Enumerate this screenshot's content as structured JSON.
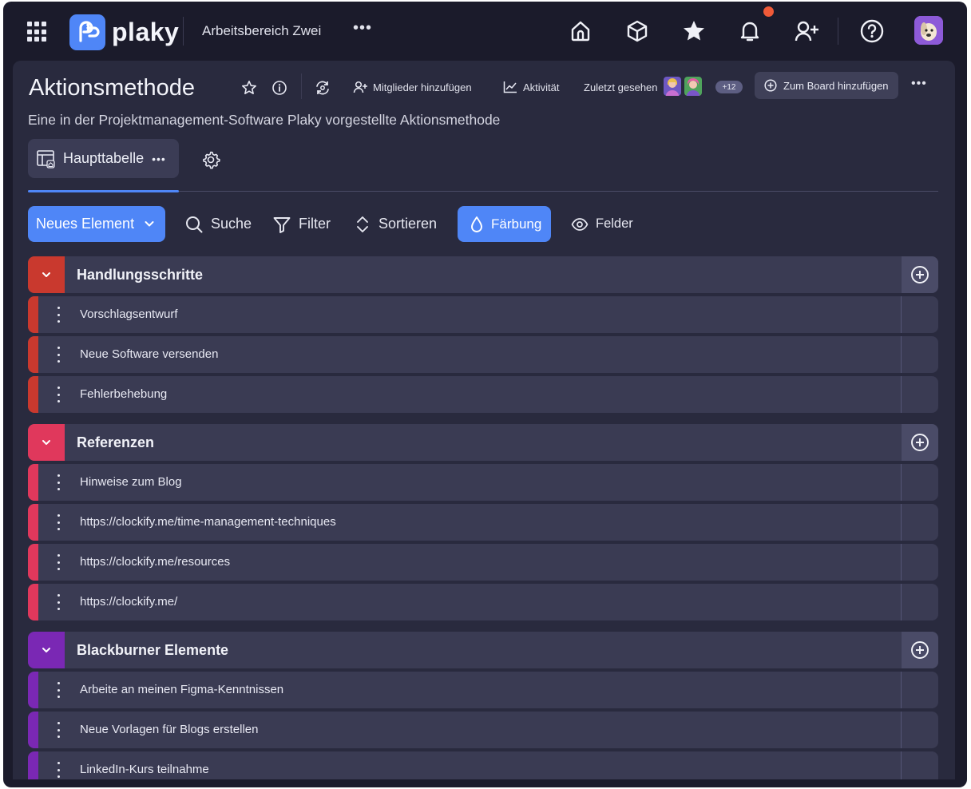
{
  "topbar": {
    "logo_text": "plaky",
    "workspace": "Arbeitsbereich Zwei",
    "more": "•••",
    "icons": [
      "home-icon",
      "cube-icon",
      "star-icon",
      "bell-icon",
      "add-user-icon",
      "help-icon"
    ],
    "notification_dot_color": "#f05a38"
  },
  "board": {
    "title": "Aktionsmethode",
    "description": "Eine in der Projektmanagement-Software Plaky vorgestellte Aktionsmethode",
    "add_members": "Mitglieder hinzufügen",
    "activity": "Aktivität",
    "last_seen": "Zuletzt gesehen",
    "viewer_count": "+12",
    "add_to_board": "Zum Board hinzufügen",
    "more": "•••"
  },
  "view_tab": {
    "label": "Haupttabelle",
    "more": "•••"
  },
  "toolbar": {
    "new_item": "Neues Element",
    "search": "Suche",
    "filter": "Filter",
    "sort": "Sortieren",
    "coloring": "Färbung",
    "fields": "Felder"
  },
  "colors": {
    "accent": "#4f86f7",
    "background": "#1b1b2b",
    "panel": "#292a3e",
    "row": "#3a3b53"
  },
  "groups": [
    {
      "title": "Handlungsschritte",
      "color": "#c9392e",
      "items": [
        "Vorschlagsentwurf",
        "Neue Software versenden",
        "Fehlerbehebung"
      ]
    },
    {
      "title": "Referenzen",
      "color": "#e0385c",
      "items": [
        "Hinweise zum Blog",
        "https://clockify.me/time-management-techniques",
        "https://clockify.me/resources",
        "https://clockify.me/"
      ]
    },
    {
      "title": "Blackburner Elemente",
      "color": "#7a28b4",
      "items": [
        "Arbeite an meinen Figma-Kenntnissen",
        "Neue Vorlagen für Blogs erstellen",
        "LinkedIn-Kurs teilnahme"
      ]
    }
  ]
}
